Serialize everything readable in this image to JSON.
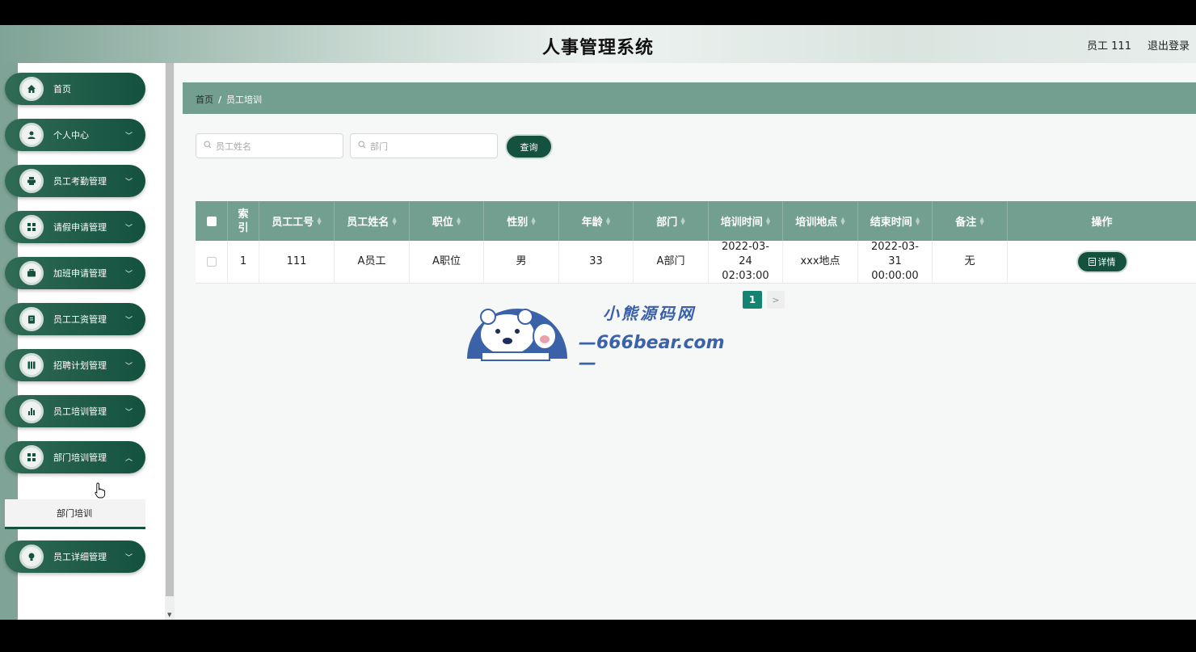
{
  "header": {
    "title": "人事管理系统",
    "user": "员工 111",
    "logout": "退出登录"
  },
  "sidebar": {
    "items": [
      {
        "label": "首页",
        "icon": "home-icon",
        "has_children": false
      },
      {
        "label": "个人中心",
        "icon": "user-icon",
        "has_children": true
      },
      {
        "label": "员工考勤管理",
        "icon": "print-icon",
        "has_children": true
      },
      {
        "label": "请假申请管理",
        "icon": "grid-icon",
        "has_children": true
      },
      {
        "label": "加班申请管理",
        "icon": "briefcase-icon",
        "has_children": true
      },
      {
        "label": "员工工资管理",
        "icon": "clipboard-icon",
        "has_children": true
      },
      {
        "label": "招聘计划管理",
        "icon": "book-icon",
        "has_children": true
      },
      {
        "label": "员工培训管理",
        "icon": "bar-chart-icon",
        "has_children": true
      },
      {
        "label": "部门培训管理",
        "icon": "grid-icon",
        "has_children": true
      },
      {
        "label": "员工详细管理",
        "icon": "bulb-icon",
        "has_children": true
      }
    ],
    "submenu_label": "部门培训"
  },
  "breadcrumb": {
    "home": "首页",
    "separator": "/",
    "current": "员工培训"
  },
  "search": {
    "name_placeholder": "员工姓名",
    "dept_placeholder": "部门",
    "query_label": "查询"
  },
  "table": {
    "columns": [
      "索引",
      "员工工号",
      "员工姓名",
      "职位",
      "性别",
      "年龄",
      "部门",
      "培训时间",
      "培训地点",
      "结束时间",
      "备注",
      "操作"
    ],
    "rows": [
      {
        "index": "1",
        "emp_no": "111",
        "name": "A员工",
        "position": "A职位",
        "gender": "男",
        "age": "33",
        "dept": "A部门",
        "train_time": "2022-03-24 02:03:00",
        "location": "xxx地点",
        "end_time": "2022-03-31 00:00:00",
        "remark": "无",
        "action": "详情"
      }
    ]
  },
  "pagination": {
    "current_page": "1",
    "next": ">"
  },
  "watermark": {
    "line1": "小熊源码网",
    "line2": "—666bear.com—"
  },
  "colors": {
    "primary": "#14513f",
    "header_bg": "#729f8f",
    "accent": "#14836f"
  }
}
